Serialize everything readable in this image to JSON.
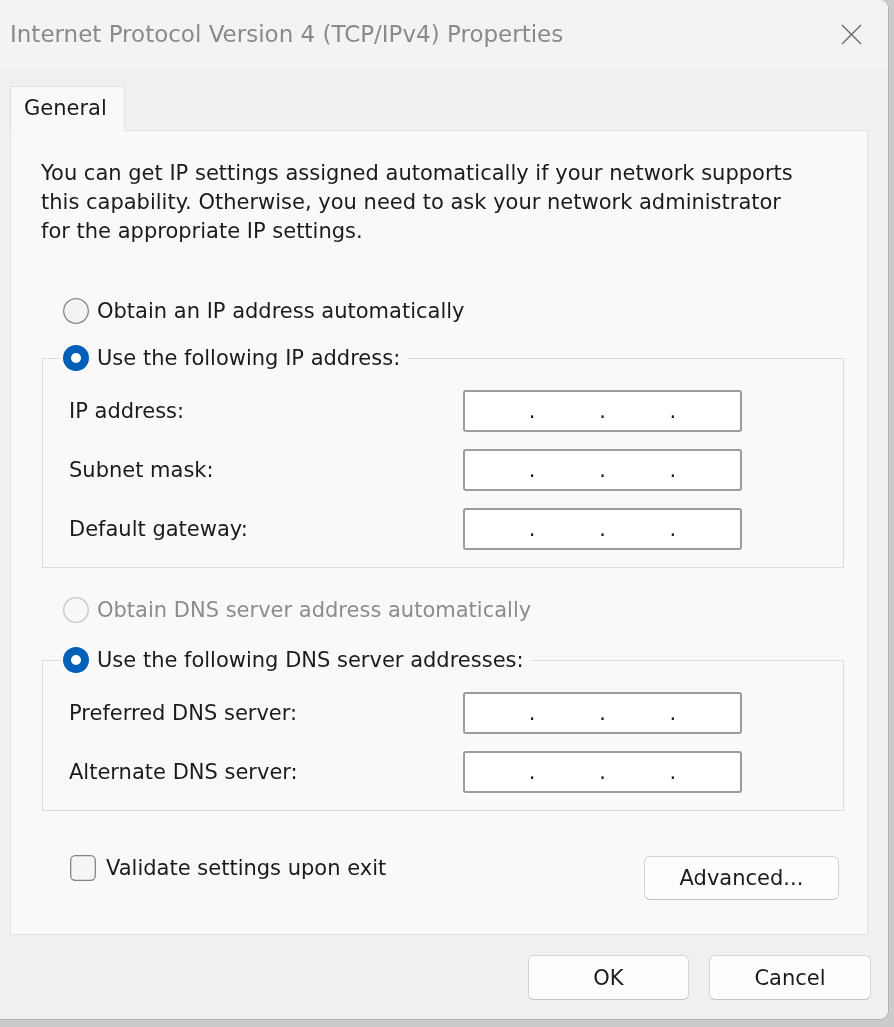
{
  "window": {
    "title": "Internet Protocol Version 4 (TCP/IPv4) Properties"
  },
  "tabs": [
    {
      "label": "General",
      "selected": true
    }
  ],
  "description": "You can get IP settings assigned automatically if your network supports this capability. Otherwise, you need to ask your network administrator for the appropriate IP settings.",
  "ip_settings": {
    "options": [
      {
        "label": "Obtain an IP address automatically",
        "selected": false,
        "disabled": false
      },
      {
        "label": "Use the following IP address:",
        "selected": true,
        "disabled": false
      }
    ],
    "fields": [
      {
        "label": "IP address:",
        "separators": [
          ".",
          ".",
          "."
        ]
      },
      {
        "label": "Subnet mask:",
        "separators": [
          ".",
          ".",
          "."
        ]
      },
      {
        "label": "Default gateway:",
        "separators": [
          ".",
          ".",
          "."
        ]
      }
    ]
  },
  "dns_settings": {
    "options": [
      {
        "label": "Obtain DNS server address automatically",
        "selected": false,
        "disabled": true
      },
      {
        "label": "Use the following DNS server addresses:",
        "selected": true,
        "disabled": false
      }
    ],
    "fields": [
      {
        "label": "Preferred DNS server:",
        "separators": [
          ".",
          ".",
          "."
        ]
      },
      {
        "label": "Alternate DNS server:",
        "separators": [
          ".",
          ".",
          "."
        ]
      }
    ]
  },
  "validate_checkbox": {
    "label": "Validate settings upon exit",
    "checked": false
  },
  "advanced_button": "Advanced...",
  "buttons": [
    "OK",
    "Cancel"
  ]
}
